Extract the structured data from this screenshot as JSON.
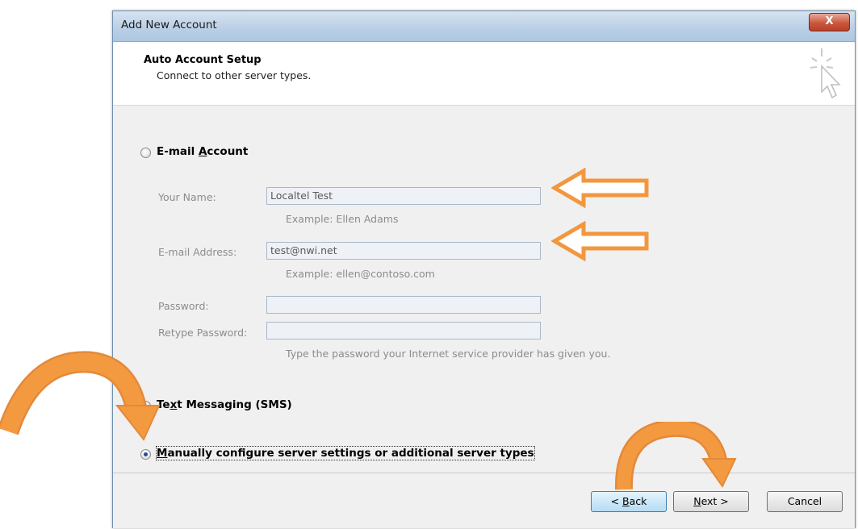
{
  "window": {
    "title": "Add New Account",
    "close_label": "X"
  },
  "header": {
    "title": "Auto Account Setup",
    "subtitle": "Connect to other server types."
  },
  "email_account": {
    "label_pre": "E-mail ",
    "label_accel": "A",
    "label_post": "ccount",
    "your_name": {
      "label": "Your Name:",
      "value": "Localtel Test",
      "example": "Example: Ellen Adams"
    },
    "email_address": {
      "label": "E-mail Address:",
      "value": "test@nwi.net",
      "example": "Example: ellen@contoso.com"
    },
    "password": {
      "label": "Password:",
      "value": ""
    },
    "retype_password": {
      "label": "Retype Password:",
      "value": ""
    },
    "password_hint": "Type the password your Internet service provider has given you."
  },
  "sms_option": {
    "label_pre": "Te",
    "label_accel": "x",
    "label_post": "t Messaging (SMS)"
  },
  "manual_option": {
    "label_accel": "M",
    "label_post": "anually configure server settings or additional server types",
    "selected": true
  },
  "buttons": {
    "back": {
      "pre": "< ",
      "accel": "B",
      "post": "ack"
    },
    "next": {
      "accel": "N",
      "post": "ext >"
    },
    "cancel": "Cancel"
  },
  "colors": {
    "annotation_orange": "#f2973f",
    "annotation_outline": "#e4893a"
  },
  "icons": {
    "wizard": "wizard-cursor-icon",
    "arrow_left": "left-arrow-icon",
    "curved_arrow": "curved-arrow-icon"
  }
}
